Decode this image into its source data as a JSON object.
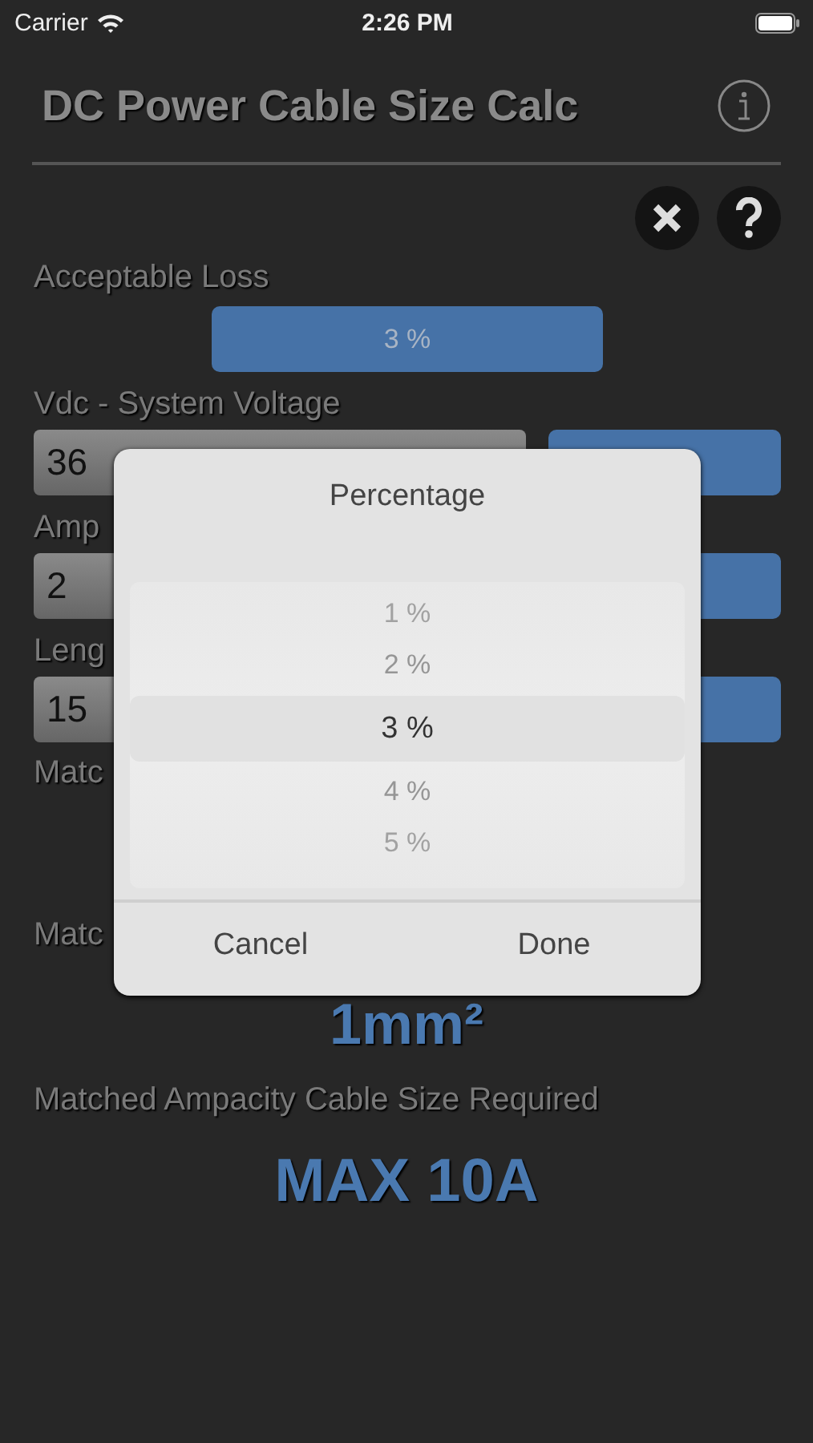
{
  "status_bar": {
    "carrier": "Carrier",
    "time": "2:26 PM"
  },
  "header": {
    "title": "DC Power Cable Size Calc"
  },
  "acceptable_loss": {
    "label": "Acceptable Loss",
    "value": "3 %"
  },
  "inputs": [
    {
      "label": "Vdc - System Voltage",
      "value": "36"
    },
    {
      "label": "Amp",
      "value": "2"
    },
    {
      "label": "Leng",
      "value": "15"
    }
  ],
  "results": [
    {
      "kind": "label",
      "text": "Matc"
    },
    {
      "kind": "label",
      "text": "Matc"
    },
    {
      "kind": "value",
      "text": "1mm²"
    },
    {
      "kind": "label",
      "text": "Matched Ampacity Cable Size Required"
    },
    {
      "kind": "value",
      "text": "MAX 10A"
    }
  ],
  "picker_dialog": {
    "title": "Percentage",
    "options": [
      {
        "label": "1 %",
        "selected": false
      },
      {
        "label": "2 %",
        "selected": false
      },
      {
        "label": "3 %",
        "selected": true
      },
      {
        "label": "4 %",
        "selected": false
      },
      {
        "label": "5 %",
        "selected": false
      }
    ],
    "buttons": [
      "Cancel",
      "Done"
    ]
  }
}
